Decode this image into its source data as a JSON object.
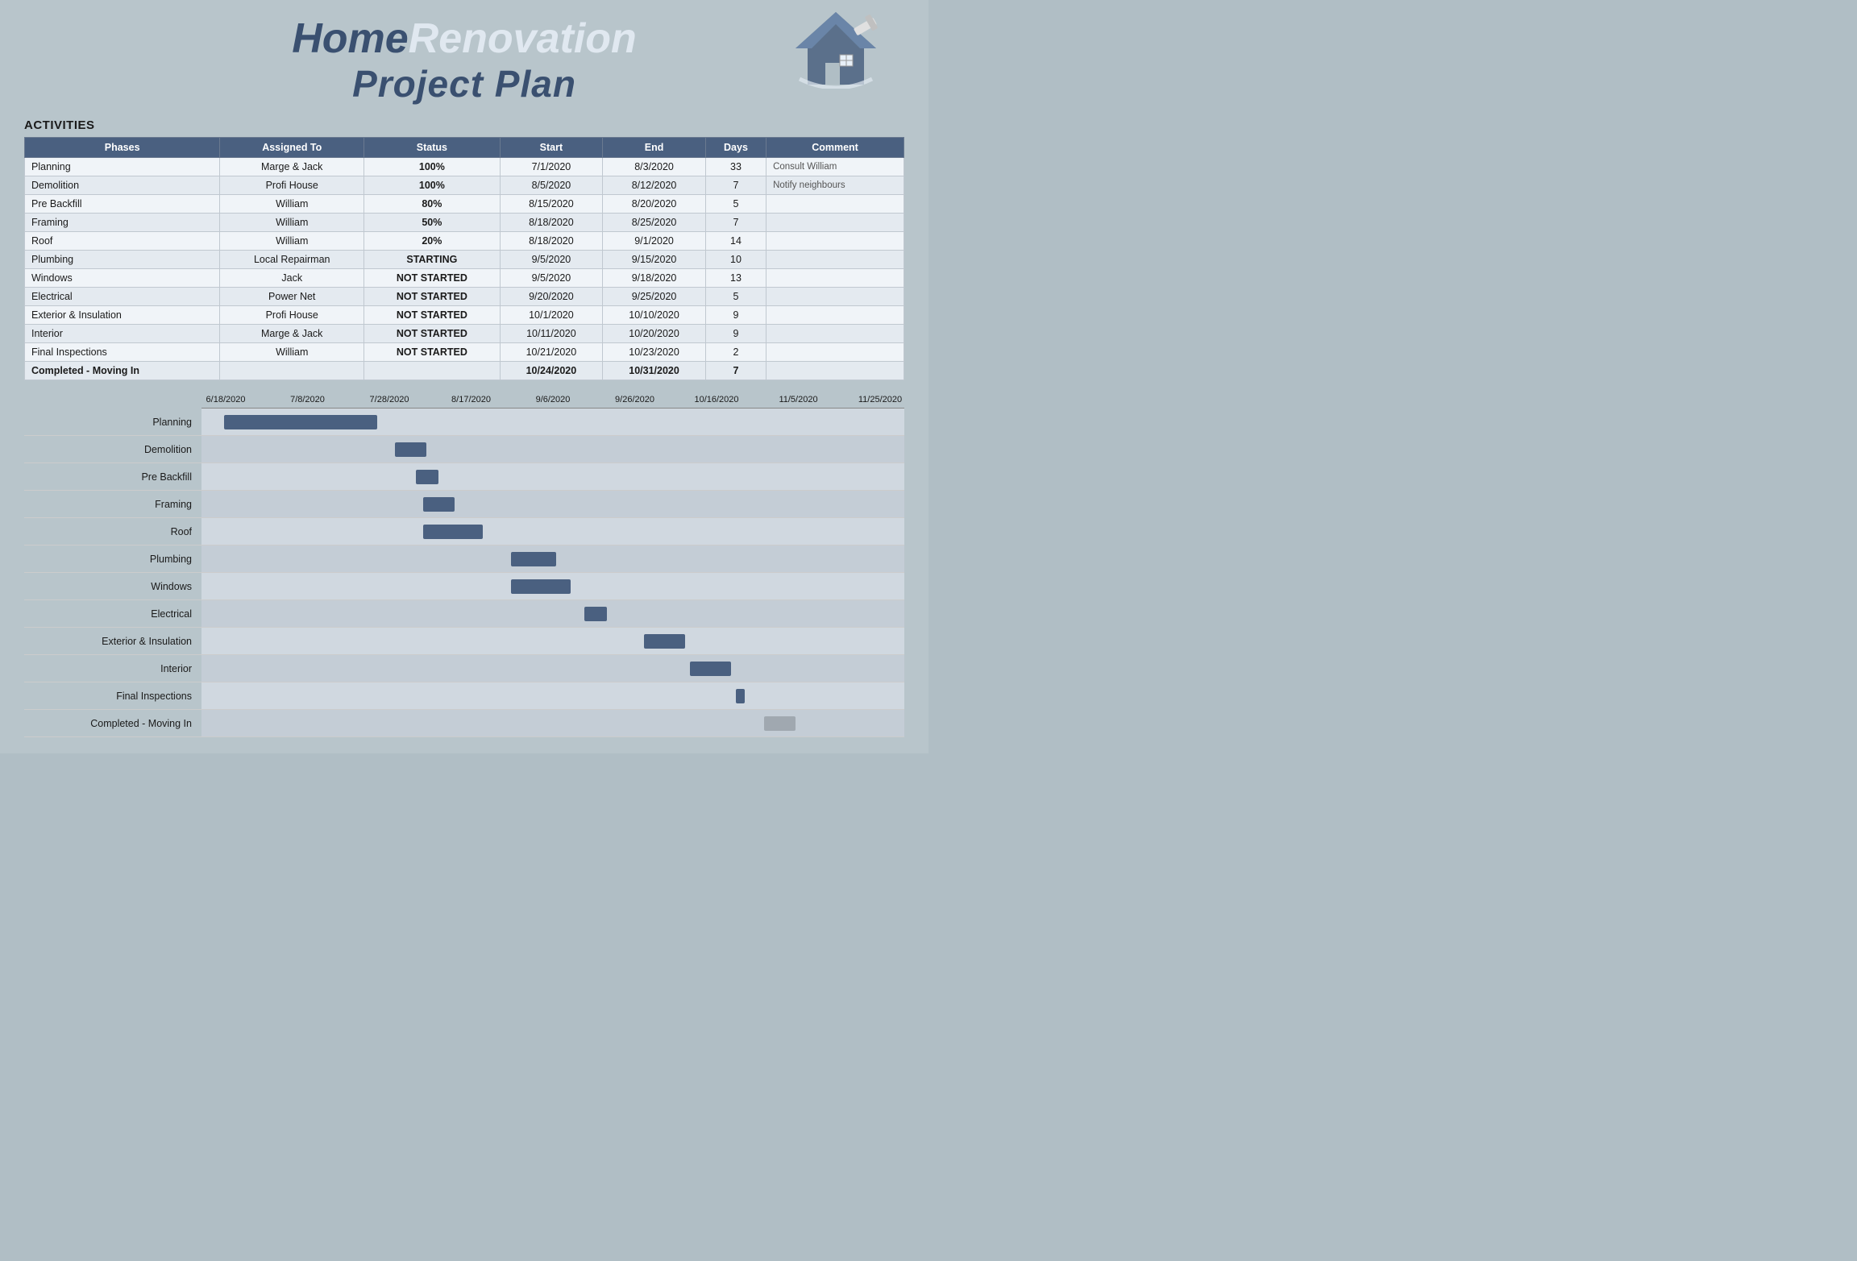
{
  "header": {
    "title_home": "Home",
    "title_renovation": "Renovation",
    "title_sub": "Project Plan"
  },
  "activities_label": "ACTIVITIES",
  "table": {
    "headers": [
      "Phases",
      "Assigned To",
      "Status",
      "Start",
      "End",
      "Days",
      "Comment"
    ],
    "rows": [
      {
        "phase": "Planning",
        "assigned": "Marge & Jack",
        "status": "100%",
        "status_class": "status-100",
        "start": "7/1/2020",
        "end": "8/3/2020",
        "days": "33",
        "comment": "Consult William",
        "bold": false
      },
      {
        "phase": "Demolition",
        "assigned": "Profi House",
        "status": "100%",
        "status_class": "status-100",
        "start": "8/5/2020",
        "end": "8/12/2020",
        "days": "7",
        "comment": "Notify neighbours",
        "bold": false
      },
      {
        "phase": "Pre Backfill",
        "assigned": "William",
        "status": "80%",
        "status_class": "status-80",
        "start": "8/15/2020",
        "end": "8/20/2020",
        "days": "5",
        "comment": "",
        "bold": false
      },
      {
        "phase": "Framing",
        "assigned": "William",
        "status": "50%",
        "status_class": "status-50",
        "start": "8/18/2020",
        "end": "8/25/2020",
        "days": "7",
        "comment": "",
        "bold": false
      },
      {
        "phase": "Roof",
        "assigned": "William",
        "status": "20%",
        "status_class": "status-20",
        "start": "8/18/2020",
        "end": "9/1/2020",
        "days": "14",
        "comment": "",
        "bold": false
      },
      {
        "phase": "Plumbing",
        "assigned": "Local Repairman",
        "status": "STARTING",
        "status_class": "status-starting",
        "start": "9/5/2020",
        "end": "9/15/2020",
        "days": "10",
        "comment": "",
        "bold": false
      },
      {
        "phase": "Windows",
        "assigned": "Jack",
        "status": "NOT STARTED",
        "status_class": "status-not-started",
        "start": "9/5/2020",
        "end": "9/18/2020",
        "days": "13",
        "comment": "",
        "bold": false
      },
      {
        "phase": "Electrical",
        "assigned": "Power Net",
        "status": "NOT STARTED",
        "status_class": "status-not-started",
        "start": "9/20/2020",
        "end": "9/25/2020",
        "days": "5",
        "comment": "",
        "bold": false
      },
      {
        "phase": "Exterior & Insulation",
        "assigned": "Profi House",
        "status": "NOT STARTED",
        "status_class": "status-not-started",
        "start": "10/1/2020",
        "end": "10/10/2020",
        "days": "9",
        "comment": "",
        "bold": false
      },
      {
        "phase": "Interior",
        "assigned": "Marge & Jack",
        "status": "NOT STARTED",
        "status_class": "status-not-started",
        "start": "10/11/2020",
        "end": "10/20/2020",
        "days": "9",
        "comment": "",
        "bold": false
      },
      {
        "phase": "Final Inspections",
        "assigned": "William",
        "status": "NOT STARTED",
        "status_class": "status-not-started",
        "start": "10/21/2020",
        "end": "10/23/2020",
        "days": "2",
        "comment": "",
        "bold": false
      },
      {
        "phase": "Completed - Moving In",
        "assigned": "",
        "status": "",
        "status_class": "",
        "start": "10/24/2020",
        "end": "10/31/2020",
        "days": "7",
        "comment": "",
        "bold": true
      }
    ]
  },
  "gantt": {
    "dates": [
      "6/18/2020",
      "7/8/2020",
      "7/28/2020",
      "8/17/2020",
      "9/6/2020",
      "9/26/2020",
      "10/16/2020",
      "11/5/2020",
      "11/25/2020"
    ],
    "rows": [
      {
        "label": "Planning",
        "left_pct": 3.2,
        "width_pct": 21.8,
        "gray": false
      },
      {
        "label": "Demolition",
        "left_pct": 27.5,
        "width_pct": 4.5,
        "gray": false
      },
      {
        "label": "Pre Backfill",
        "left_pct": 30.5,
        "width_pct": 3.2,
        "gray": false
      },
      {
        "label": "Framing",
        "left_pct": 31.5,
        "width_pct": 4.5,
        "gray": false
      },
      {
        "label": "Roof",
        "left_pct": 31.5,
        "width_pct": 8.5,
        "gray": false
      },
      {
        "label": "Plumbing",
        "left_pct": 44.0,
        "width_pct": 6.5,
        "gray": false
      },
      {
        "label": "Windows",
        "left_pct": 44.0,
        "width_pct": 8.5,
        "gray": false
      },
      {
        "label": "Electrical",
        "left_pct": 54.5,
        "width_pct": 3.2,
        "gray": false
      },
      {
        "label": "Exterior & Insulation",
        "left_pct": 63.0,
        "width_pct": 5.8,
        "gray": false
      },
      {
        "label": "Interior",
        "left_pct": 69.5,
        "width_pct": 5.8,
        "gray": false
      },
      {
        "label": "Final Inspections",
        "left_pct": 76.0,
        "width_pct": 1.3,
        "gray": false
      },
      {
        "label": "Completed - Moving In",
        "left_pct": 80.0,
        "width_pct": 4.5,
        "gray": true
      }
    ]
  }
}
